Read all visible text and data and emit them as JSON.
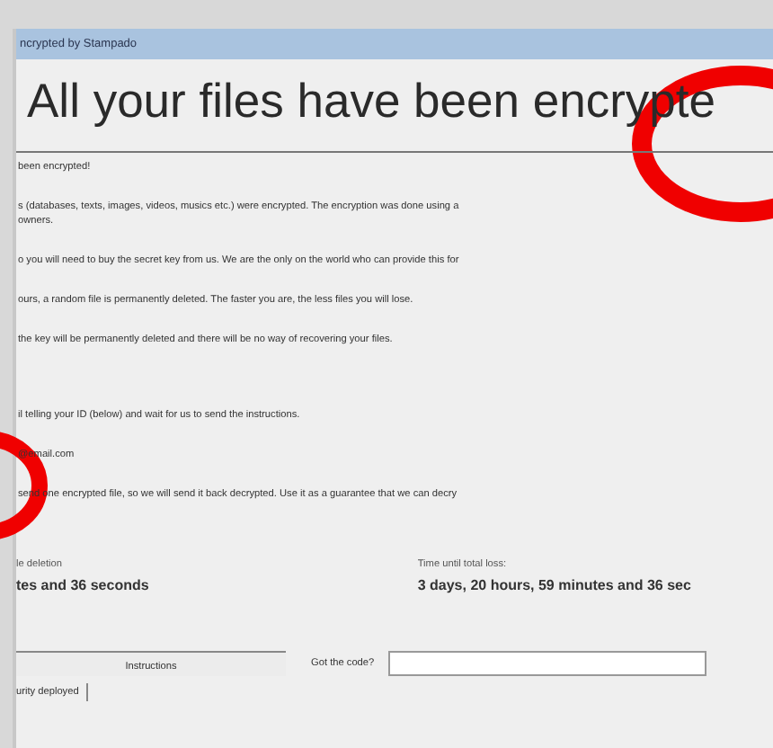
{
  "window": {
    "title": "ncrypted by Stampado"
  },
  "heading": "All your files have been encrypte",
  "paragraphs": [
    {
      "lines": [
        "been encrypted!"
      ]
    },
    {
      "lines": [
        "s (databases, texts, images, videos, musics etc.) were encrypted. The encryption was done using a",
        "owners."
      ]
    },
    {
      "lines": [
        "o you will need to buy the secret key from us. We are the only on the world who can provide this for"
      ]
    },
    {
      "lines": [
        "ours, a random file is permanently deleted. The faster you are, the less files you will lose."
      ]
    },
    {
      "lines": [
        "the key will be permanently deleted and there will be no way of recovering your files."
      ]
    },
    {
      "lines": [
        "il telling your ID (below) and wait for us to send the instructions."
      ],
      "gap": true
    },
    {
      "lines": [
        "@email.com"
      ]
    },
    {
      "lines": [
        "send one encrypted file, so we will send it back decrypted. Use it as a guarantee that we can decry"
      ]
    }
  ],
  "timers": [
    {
      "label": "le deletion",
      "value": "tes and 36 seconds"
    },
    {
      "label": "Time until total loss:",
      "value": "3 days, 20 hours, 59 minutes and 36 sec"
    }
  ],
  "instructions_button": "Instructions",
  "code_field": {
    "label": "Got the code?"
  },
  "footer_label": "urity deployed"
}
